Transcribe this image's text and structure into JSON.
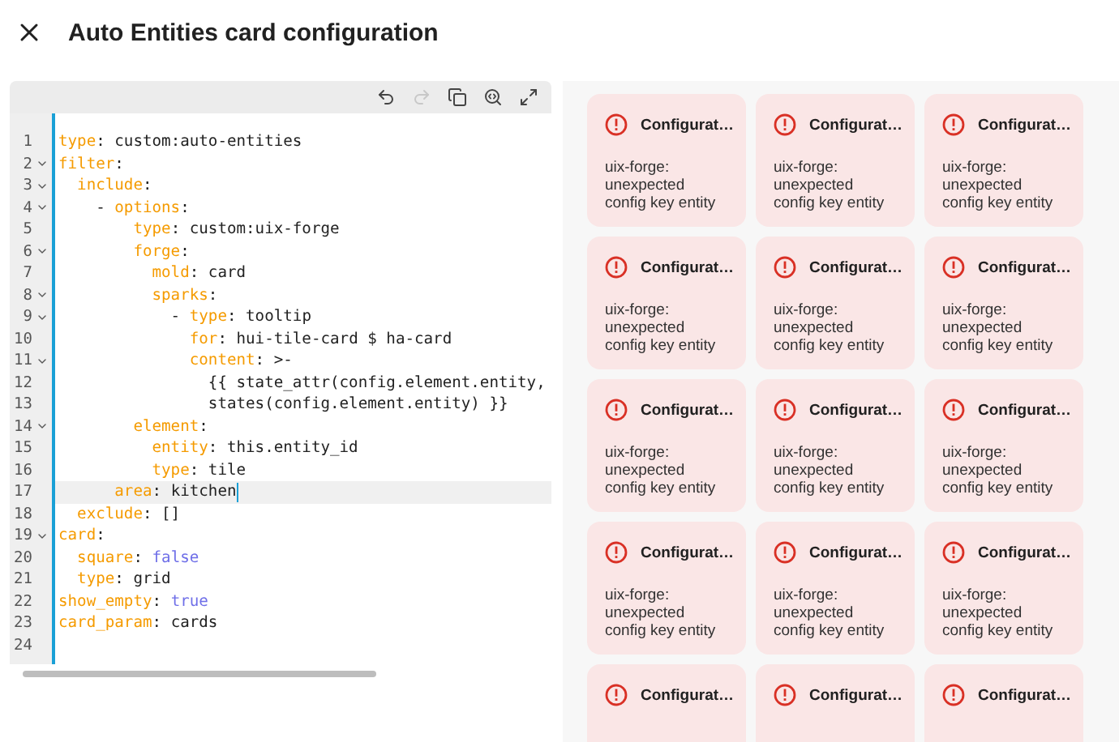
{
  "dialog": {
    "title": "Auto Entities card configuration"
  },
  "editor": {
    "toolbar": [
      {
        "kind": "undo",
        "disabled": false
      },
      {
        "kind": "redo",
        "disabled": true
      },
      {
        "kind": "copy",
        "disabled": false
      },
      {
        "kind": "search",
        "disabled": false
      },
      {
        "kind": "fullscreen",
        "disabled": false
      }
    ],
    "lines": [
      {
        "number": "1",
        "fold": false,
        "active": false,
        "tokens": [
          {
            "kind": "key",
            "text": "type"
          },
          {
            "kind": "plain",
            "text": ": custom:auto-entities"
          }
        ]
      },
      {
        "number": "2",
        "fold": true,
        "active": false,
        "tokens": [
          {
            "kind": "key",
            "text": "filter"
          },
          {
            "kind": "plain",
            "text": ":"
          }
        ]
      },
      {
        "number": "3",
        "fold": true,
        "active": false,
        "tokens": [
          {
            "kind": "key",
            "text": "  include"
          },
          {
            "kind": "plain",
            "text": ":"
          }
        ]
      },
      {
        "number": "4",
        "fold": true,
        "active": false,
        "tokens": [
          {
            "kind": "plain",
            "text": "    - "
          },
          {
            "kind": "key",
            "text": "options"
          },
          {
            "kind": "plain",
            "text": ":"
          }
        ]
      },
      {
        "number": "5",
        "fold": false,
        "active": false,
        "tokens": [
          {
            "kind": "key",
            "text": "        type"
          },
          {
            "kind": "plain",
            "text": ": custom:uix-forge"
          }
        ]
      },
      {
        "number": "6",
        "fold": true,
        "active": false,
        "tokens": [
          {
            "kind": "key",
            "text": "        forge"
          },
          {
            "kind": "plain",
            "text": ":"
          }
        ]
      },
      {
        "number": "7",
        "fold": false,
        "active": false,
        "tokens": [
          {
            "kind": "key",
            "text": "          mold"
          },
          {
            "kind": "plain",
            "text": ": card"
          }
        ]
      },
      {
        "number": "8",
        "fold": true,
        "active": false,
        "tokens": [
          {
            "kind": "key",
            "text": "          sparks"
          },
          {
            "kind": "plain",
            "text": ":"
          }
        ]
      },
      {
        "number": "9",
        "fold": true,
        "active": false,
        "tokens": [
          {
            "kind": "plain",
            "text": "            - "
          },
          {
            "kind": "key",
            "text": "type"
          },
          {
            "kind": "plain",
            "text": ": tooltip"
          }
        ]
      },
      {
        "number": "10",
        "fold": false,
        "active": false,
        "tokens": [
          {
            "kind": "key",
            "text": "              for"
          },
          {
            "kind": "plain",
            "text": ": hui-tile-card $ ha-card"
          }
        ]
      },
      {
        "number": "11",
        "fold": true,
        "active": false,
        "tokens": [
          {
            "kind": "key",
            "text": "              content"
          },
          {
            "kind": "plain",
            "text": ": >-"
          }
        ]
      },
      {
        "number": "12",
        "fold": false,
        "active": false,
        "tokens": [
          {
            "kind": "plain",
            "text": "                {{ state_attr(config.element.entity,"
          }
        ]
      },
      {
        "number": "13",
        "fold": false,
        "active": false,
        "tokens": [
          {
            "kind": "plain",
            "text": "                states(config.element.entity) }}"
          }
        ]
      },
      {
        "number": "14",
        "fold": true,
        "active": false,
        "tokens": [
          {
            "kind": "key",
            "text": "        element"
          },
          {
            "kind": "plain",
            "text": ":"
          }
        ]
      },
      {
        "number": "15",
        "fold": false,
        "active": false,
        "tokens": [
          {
            "kind": "key",
            "text": "          entity"
          },
          {
            "kind": "plain",
            "text": ": this.entity_id"
          }
        ]
      },
      {
        "number": "16",
        "fold": false,
        "active": false,
        "tokens": [
          {
            "kind": "key",
            "text": "          type"
          },
          {
            "kind": "plain",
            "text": ": tile"
          }
        ]
      },
      {
        "number": "17",
        "fold": false,
        "active": true,
        "tokens": [
          {
            "kind": "key",
            "text": "      area"
          },
          {
            "kind": "plain",
            "text": ": kitchen"
          }
        ]
      },
      {
        "number": "18",
        "fold": false,
        "active": false,
        "tokens": [
          {
            "kind": "key",
            "text": "  exclude"
          },
          {
            "kind": "plain",
            "text": ": []"
          }
        ]
      },
      {
        "number": "19",
        "fold": true,
        "active": false,
        "tokens": [
          {
            "kind": "key",
            "text": "card"
          },
          {
            "kind": "plain",
            "text": ":"
          }
        ]
      },
      {
        "number": "20",
        "fold": false,
        "active": false,
        "tokens": [
          {
            "kind": "key",
            "text": "  square"
          },
          {
            "kind": "plain",
            "text": ": "
          },
          {
            "kind": "bool",
            "text": "false"
          }
        ]
      },
      {
        "number": "21",
        "fold": false,
        "active": false,
        "tokens": [
          {
            "kind": "key",
            "text": "  type"
          },
          {
            "kind": "plain",
            "text": ": grid"
          }
        ]
      },
      {
        "number": "22",
        "fold": false,
        "active": false,
        "tokens": [
          {
            "kind": "key",
            "text": "show_empty"
          },
          {
            "kind": "plain",
            "text": ": "
          },
          {
            "kind": "bool",
            "text": "true"
          }
        ]
      },
      {
        "number": "23",
        "fold": false,
        "active": false,
        "tokens": [
          {
            "kind": "key",
            "text": "card_param"
          },
          {
            "kind": "plain",
            "text": ": cards"
          }
        ]
      },
      {
        "number": "24",
        "fold": false,
        "active": false
      }
    ]
  },
  "preview": {
    "cards": [
      {
        "title": "Configurat…",
        "message": "uix-forge: unexpected config key entity"
      },
      {
        "title": "Configurat…",
        "message": "uix-forge: unexpected config key entity"
      },
      {
        "title": "Configurat…",
        "message": "uix-forge: unexpected config key entity"
      },
      {
        "title": "Configurat…",
        "message": "uix-forge: unexpected config key entity"
      },
      {
        "title": "Configurat…",
        "message": "uix-forge: unexpected config key entity"
      },
      {
        "title": "Configurat…",
        "message": "uix-forge: unexpected config key entity"
      },
      {
        "title": "Configurat…",
        "message": "uix-forge: unexpected config key entity"
      },
      {
        "title": "Configurat…",
        "message": "uix-forge: unexpected config key entity"
      },
      {
        "title": "Configurat…",
        "message": "uix-forge: unexpected config key entity"
      },
      {
        "title": "Configurat…",
        "message": "uix-forge: unexpected config key entity"
      },
      {
        "title": "Configurat…",
        "message": "uix-forge: unexpected config key entity"
      },
      {
        "title": "Configurat…",
        "message": "uix-forge: unexpected config key entity"
      },
      {
        "title": "Configurat…"
      },
      {
        "title": "Configurat…"
      },
      {
        "title": "Configurat…"
      }
    ]
  }
}
